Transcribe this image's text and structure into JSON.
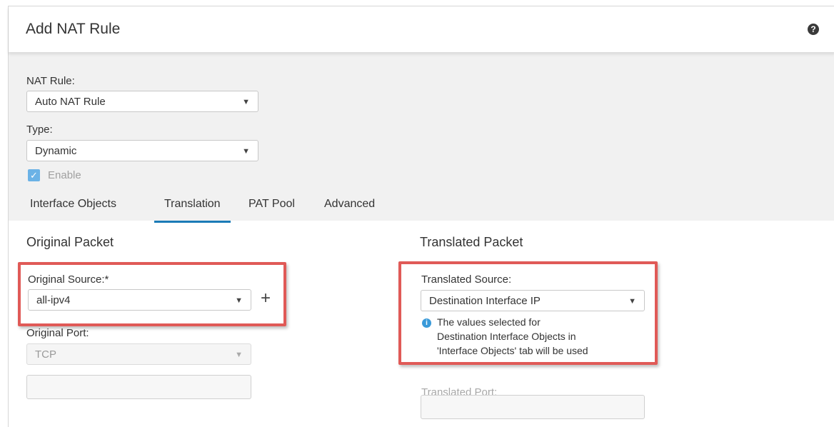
{
  "dialog": {
    "title": "Add NAT Rule",
    "help_icon": "question-circle-icon"
  },
  "nat_rule": {
    "label": "NAT Rule:",
    "value": "Auto NAT Rule"
  },
  "type": {
    "label": "Type:",
    "value": "Dynamic"
  },
  "enable": {
    "label": "Enable",
    "checked": true
  },
  "tabs": [
    {
      "label": "Interface Objects",
      "active": false
    },
    {
      "label": "Translation",
      "active": true
    },
    {
      "label": "PAT Pool",
      "active": false
    },
    {
      "label": "Advanced",
      "active": false
    }
  ],
  "original_packet": {
    "title": "Original Packet",
    "source_label": "Original Source:*",
    "source_value": "all-ipv4",
    "add_symbol": "+",
    "port_label": "Original Port:",
    "port_protocol": "TCP",
    "port_value": ""
  },
  "translated_packet": {
    "title": "Translated Packet",
    "source_label": "Translated Source:",
    "source_value": "Destination Interface IP",
    "info_line1": "The values selected for",
    "info_line2": "Destination Interface Objects in",
    "info_line3": "'Interface Objects' tab will be used",
    "port_label": "Translated Port:",
    "port_value": ""
  },
  "colors": {
    "accent": "#1b7bb7",
    "highlight": "#e05a57",
    "checkbox": "#6bb2e6",
    "info": "#3a9ad9"
  }
}
